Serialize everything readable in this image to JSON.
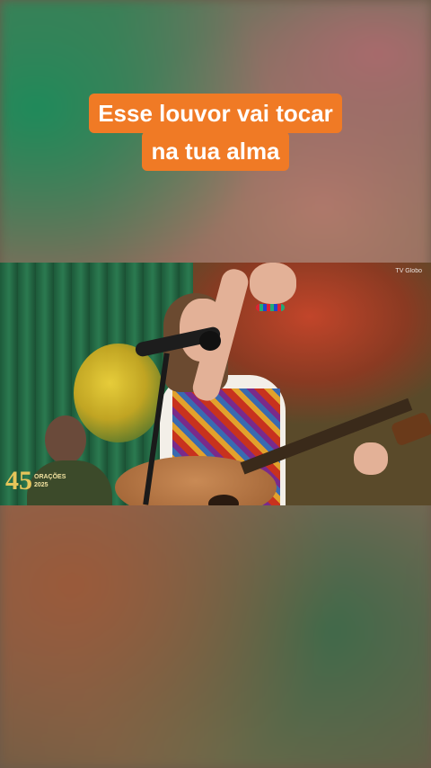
{
  "caption": {
    "line1": "Esse louvor vai tocar",
    "line2": "na tua alma",
    "background_color": "#f07a25",
    "text_color": "#ffffff"
  },
  "video": {
    "watermark": "TV Globo",
    "logo": {
      "number": "45",
      "text_top": "ORAÇÕES",
      "text_bottom": "2025"
    }
  }
}
